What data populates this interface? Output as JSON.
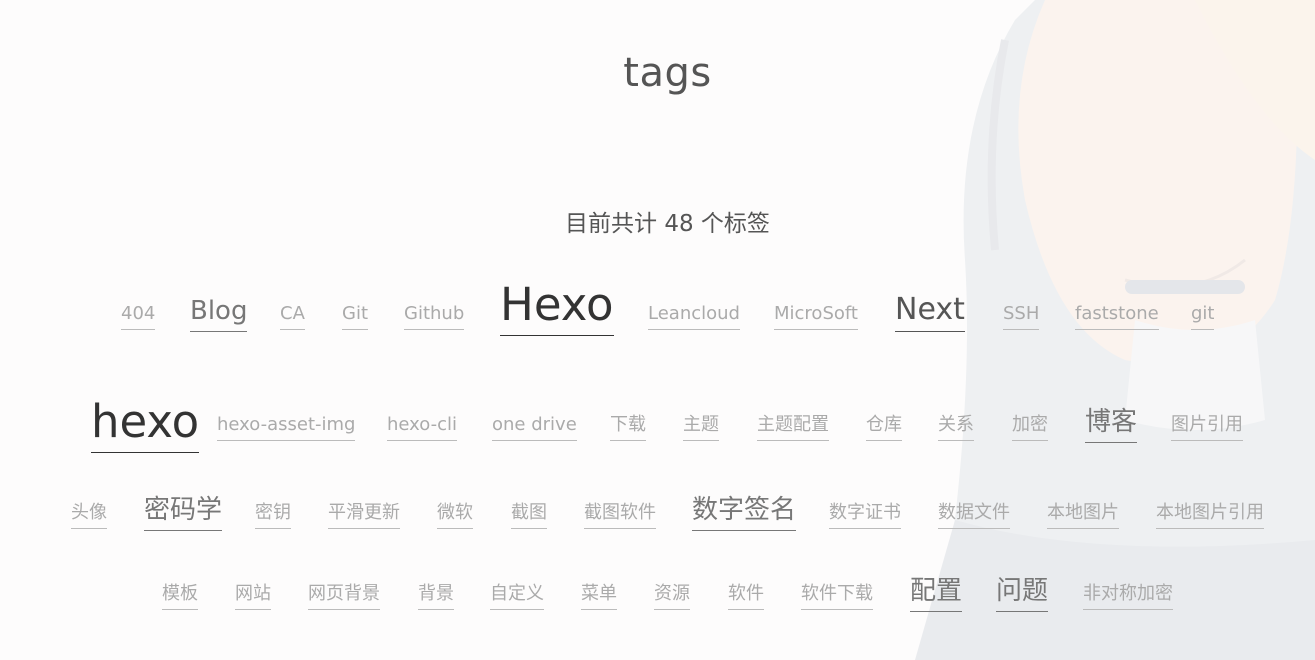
{
  "page": {
    "title": "tags",
    "tag_count_text": "目前共计 48 个标签"
  },
  "tags": [
    "404",
    "Blog",
    "CA",
    "Git",
    "Github",
    "Hexo",
    "Leancloud",
    "MicroSoft",
    "Next",
    "SSH",
    "faststone",
    "git",
    "hexo",
    "hexo-asset-img",
    "hexo-cli",
    "one drive",
    "下载",
    "主题",
    "主题配置",
    "仓库",
    "关系",
    "加密",
    "博客",
    "图片引用",
    "头像",
    "密码学",
    "密钥",
    "平滑更新",
    "微软",
    "截图",
    "截图软件",
    "数字签名",
    "数字证书",
    "数据文件",
    "本地图片",
    "本地图片引用",
    "模板",
    "网站",
    "网页背景",
    "背景",
    "自定义",
    "菜单",
    "资源",
    "软件",
    "软件下载",
    "配置",
    "问题",
    "非对称加密"
  ]
}
